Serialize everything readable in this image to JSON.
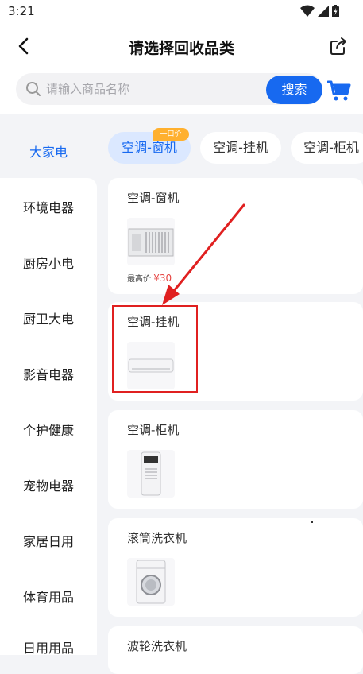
{
  "status_bar": {
    "time": "3:21"
  },
  "header": {
    "title": "请选择回收品类"
  },
  "search": {
    "placeholder": "请输入商品名称",
    "button_label": "搜索"
  },
  "sidebar": {
    "active": "大家电",
    "items": [
      "环境电器",
      "厨房小电",
      "厨卫大电",
      "影音电器",
      "个护健康",
      "宠物电器",
      "家居日用",
      "体育用品",
      "日用用品"
    ]
  },
  "tabs": [
    {
      "label": "空调-窗机",
      "active": true,
      "badge": "一口价"
    },
    {
      "label": "空调-挂机",
      "active": false
    },
    {
      "label": "空调-柜机",
      "active": false
    }
  ],
  "products": [
    {
      "title": "空调-窗机",
      "icon": "window-ac-icon",
      "price_label": "最高价",
      "price_value": "¥30"
    },
    {
      "title": "空调-挂机",
      "icon": "wall-ac-icon"
    },
    {
      "title": "空调-柜机",
      "icon": "floor-ac-icon"
    },
    {
      "title": "滚筒洗衣机",
      "icon": "front-load-washer-icon"
    },
    {
      "title": "波轮洗衣机",
      "icon": "top-load-washer-icon"
    }
  ],
  "colors": {
    "accent": "#1769f0",
    "annotation": "#e02020",
    "price": "#e64340",
    "badge": "#ffb02e"
  }
}
